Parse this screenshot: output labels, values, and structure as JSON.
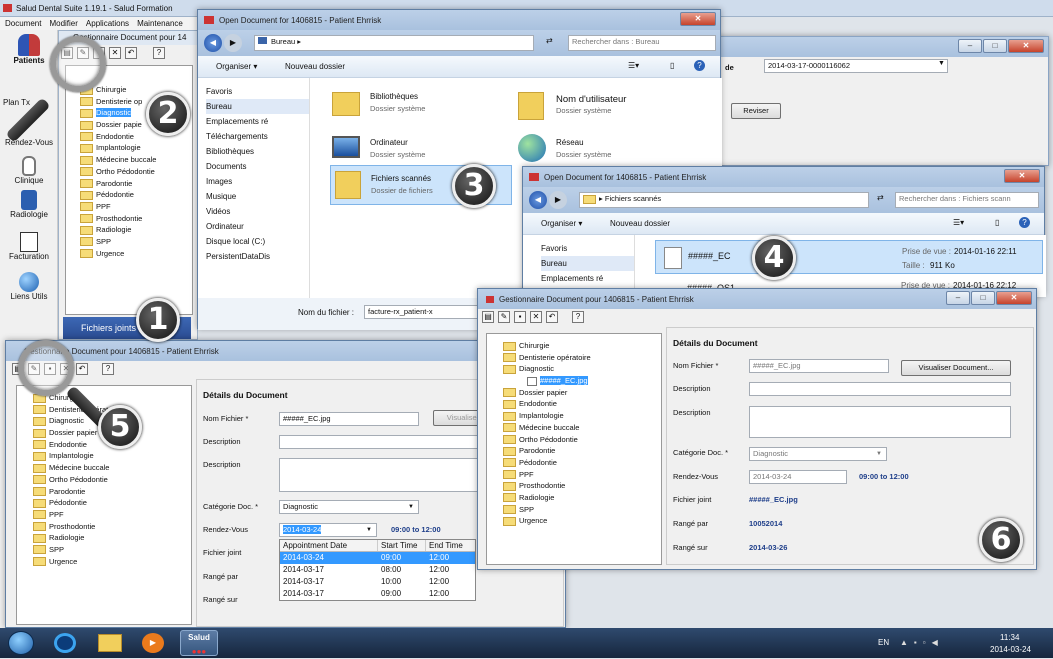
{
  "app": {
    "title": "Salud Dental Suite 1.19.1 - Salud Formation",
    "menu": [
      "Document",
      "Modifier",
      "Applications",
      "Maintenance"
    ]
  },
  "sidebar": {
    "items": [
      "Patients",
      "Plan Tx",
      "Rendez-Vous",
      "Clinique",
      "Radiologie",
      "Facturation",
      "Liens Utils"
    ],
    "attached_button": "Fichiers joints"
  },
  "bg_window": {
    "title": "Gestionnaire Document pour 14",
    "tree": [
      "Chirurgie",
      "Dentisterie op",
      "Diagnostic",
      "Dossier papie",
      "Endodontie",
      "Implantologie",
      "Médecine buccale",
      "Ortho Pédodontie",
      "Parodontie",
      "Pédodontie",
      "PPF",
      "Prosthodontie",
      "Radiologie",
      "SPP",
      "Urgence"
    ],
    "code_label": "de",
    "code_value": "2014-03-17-0000116062",
    "revise_label": "Reviser"
  },
  "dialog1": {
    "title": "Open Document for 1406815 - Patient Ehrrisk",
    "path": "Bureau",
    "search_placeholder": "Rechercher dans : Bureau",
    "organize": "Organiser ▾",
    "new_folder": "Nouveau dossier",
    "nav": [
      "Favoris",
      "Bureau",
      "Emplacements ré",
      "Téléchargements",
      "Bibliothèques",
      "Documents",
      "Images",
      "Musique",
      "Vidéos",
      "Ordinateur",
      "Disque local (C:)",
      "PersistentDataDis"
    ],
    "items": [
      {
        "name": "Bibliothèques",
        "sub": "Dossier système"
      },
      {
        "name": "Nom d'utilisateur",
        "sub": "Dossier système"
      },
      {
        "name": "Ordinateur",
        "sub": "Dossier système"
      },
      {
        "name": "Réseau",
        "sub": "Dossier système"
      },
      {
        "name": "Fichiers scannés",
        "sub": "Dossier de fichiers"
      }
    ],
    "filename_label": "Nom du fichier :",
    "filename_value": "facture-rx_patient-x"
  },
  "dialog2": {
    "title": "Open Document for 1406815 - Patient Ehrrisk",
    "path": "Fichiers scannés",
    "search_placeholder": "Rechercher dans : Fichiers scann",
    "organize": "Organiser ▾",
    "new_folder": "Nouveau dossier",
    "nav": [
      "Favoris",
      "Bureau",
      "Emplacements ré"
    ],
    "files": [
      {
        "name": "#####_EC",
        "taken_label": "Prise de vue :",
        "taken": "2014-01-16 22:11",
        "size_label": "Taille :",
        "size": "911 Ko"
      },
      {
        "name": "#####_OS1",
        "taken_label": "Prise de vue :",
        "taken": "2014-01-16 22:12"
      }
    ]
  },
  "doc5": {
    "title": "Gestionnaire Document pour 1406815 - Patient Ehrrisk",
    "tree": [
      "Chirurgie",
      "Dentisterie opératoire",
      "Diagnostic",
      "Dossier papier",
      "Endodontie",
      "Implantologie",
      "Médecine buccale",
      "Ortho Pédodontie",
      "Parodontie",
      "Pédodontie",
      "PPF",
      "Prosthodontie",
      "Radiologie",
      "SPP",
      "Urgence"
    ],
    "details_title": "Détails du Document",
    "filename_label": "Nom Fichier *",
    "filename": "#####_EC.jpg",
    "view_button": "Visualiser",
    "description_label": "Description",
    "description2_label": "Description",
    "category_label": "Catégorie Doc. *",
    "category": "Diagnostic",
    "rdv_label": "Rendez-Vous",
    "rdv_value": "2014-03-24",
    "rdv_time": "09:00 to 12:00",
    "attached_label": "Fichier joint",
    "stored_label": "Rangé par",
    "stored_on_label": "Rangé sur",
    "dropdown_headers": [
      "Appointment Date",
      "Start Time",
      "End Time"
    ],
    "dropdown_rows": [
      [
        "2014-03-24",
        "09:00",
        "12:00"
      ],
      [
        "2014-03-17",
        "08:00",
        "12:00"
      ],
      [
        "2014-03-17",
        "10:00",
        "12:00"
      ],
      [
        "2014-03-17",
        "09:00",
        "12:00"
      ]
    ]
  },
  "doc6": {
    "title": "Gestionnaire Document pour 1406815 - Patient Ehrrisk",
    "tree": [
      "Chirurgie",
      "Dentisterie opératoire",
      "Diagnostic",
      "#####_EC.jpg",
      "Dossier papier",
      "Endodontie",
      "Implantologie",
      "Médecine buccale",
      "Ortho Pédodontie",
      "Parodontie",
      "Pédodontie",
      "PPF",
      "Prosthodontie",
      "Radiologie",
      "SPP",
      "Urgence"
    ],
    "details_title": "Détails du Document",
    "filename_label": "Nom Fichier *",
    "filename": "#####_EC.jpg",
    "view_button": "Visualiser Document...",
    "description_label": "Description",
    "description2_label": "Description",
    "category_label": "Catégorie Doc. *",
    "category": "Diagnostic",
    "rdv_label": "Rendez-Vous",
    "rdv_value": "2014-03-24",
    "rdv_time": "09:00 to 12:00",
    "attached_label": "Fichier joint",
    "attached": "#####_EC.jpg",
    "stored_label": "Rangé par",
    "stored": "10052014",
    "stored_on_label": "Rangé sur",
    "stored_on": "2014-03-26"
  },
  "badges": [
    "1",
    "2",
    "3",
    "4",
    "5",
    "6"
  ],
  "taskbar": {
    "salud": "Salud",
    "lang": "EN",
    "time": "11:34",
    "date": "2014-03-24"
  },
  "colors": {
    "accent": "#3399ff",
    "title_blue": "#1f3f8a",
    "taskbar": "#1b2d45"
  }
}
